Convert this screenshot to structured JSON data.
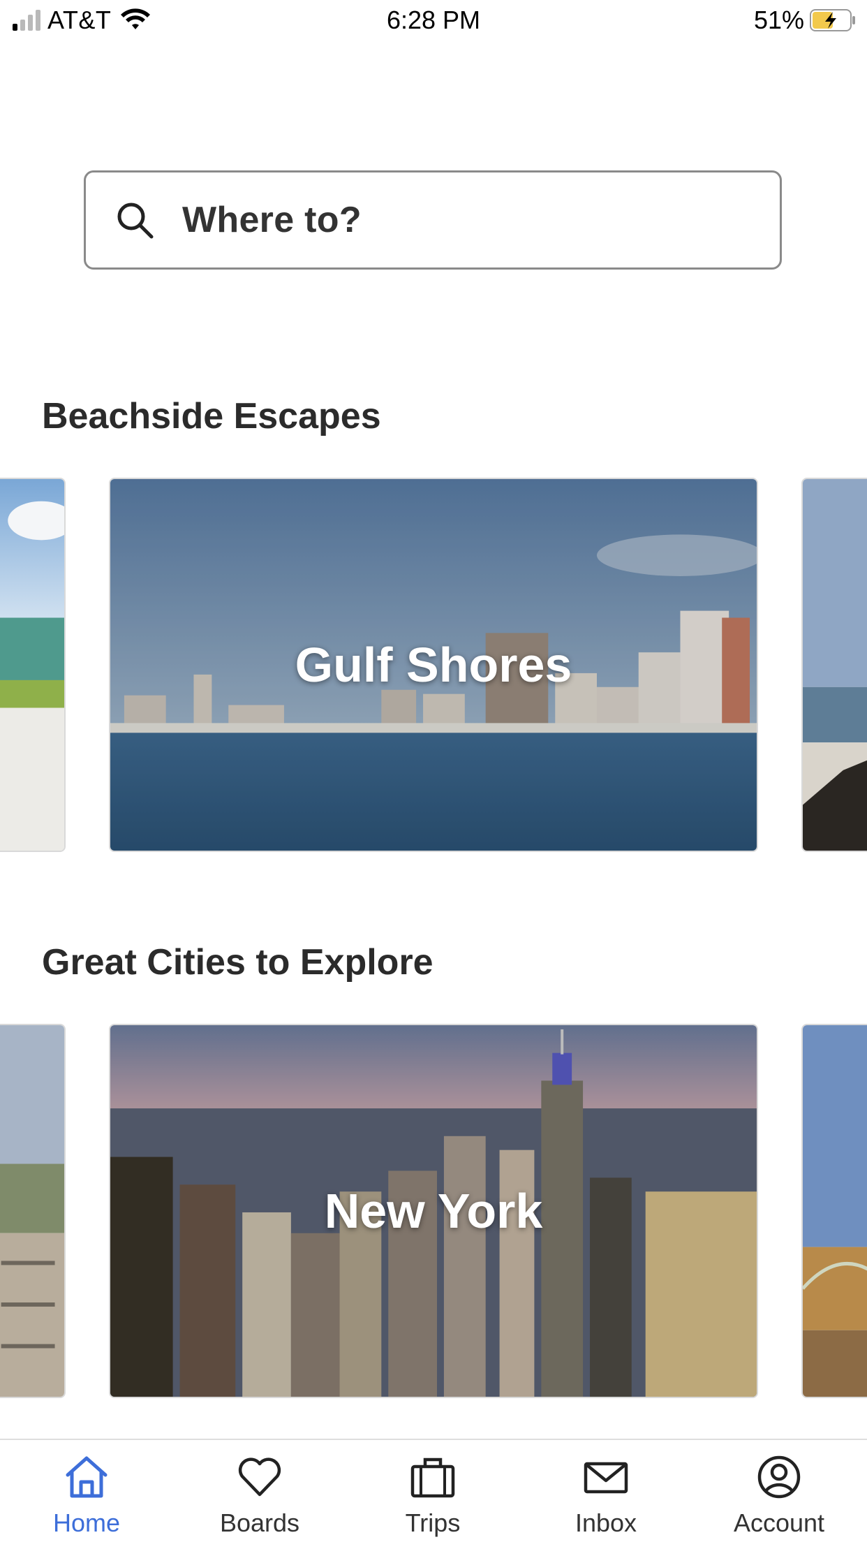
{
  "status_bar": {
    "carrier": "AT&T",
    "time": "6:28 PM",
    "battery": "51%"
  },
  "search": {
    "placeholder": "Where to?"
  },
  "sections": [
    {
      "title": "Beachside Escapes",
      "featured": "Gulf Shores"
    },
    {
      "title": "Great Cities to Explore",
      "featured": "New York"
    }
  ],
  "tabs": [
    {
      "label": "Home",
      "icon": "home-icon",
      "active": true
    },
    {
      "label": "Boards",
      "icon": "heart-icon",
      "active": false
    },
    {
      "label": "Trips",
      "icon": "suitcase-icon",
      "active": false
    },
    {
      "label": "Inbox",
      "icon": "envelope-icon",
      "active": false
    },
    {
      "label": "Account",
      "icon": "user-circle-icon",
      "active": false
    }
  ],
  "colors": {
    "accent": "#3d6ed9",
    "border": "#8a8a8a"
  }
}
